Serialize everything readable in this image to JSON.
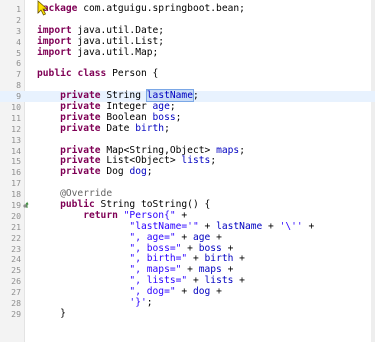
{
  "editor": {
    "lines": [
      {
        "num": "1",
        "text": "package com.atguigu.springboot.bean;"
      },
      {
        "num": "2",
        "text": ""
      },
      {
        "num": "3",
        "text": "import java.util.Date;"
      },
      {
        "num": "4",
        "text": "import java.util.List;"
      },
      {
        "num": "5",
        "text": "import java.util.Map;"
      },
      {
        "num": "6",
        "text": ""
      },
      {
        "num": "7",
        "text": "public class Person {"
      },
      {
        "num": "8",
        "text": ""
      },
      {
        "num": "9",
        "text": "    private String lastName;"
      },
      {
        "num": "10",
        "text": "    private Integer age;"
      },
      {
        "num": "11",
        "text": "    private Boolean boss;"
      },
      {
        "num": "12",
        "text": "    private Date birth;"
      },
      {
        "num": "13",
        "text": ""
      },
      {
        "num": "14",
        "text": "    private Map<String,Object> maps;"
      },
      {
        "num": "15",
        "text": "    private List<Object> lists;"
      },
      {
        "num": "16",
        "text": "    private Dog dog;"
      },
      {
        "num": "17",
        "text": ""
      },
      {
        "num": "18",
        "text": "    @Override"
      },
      {
        "num": "19",
        "text": "    public String toString() {"
      },
      {
        "num": "20",
        "text": "        return \"Person{\" +"
      },
      {
        "num": "21",
        "text": "                \"lastName='\" + lastName + '\\'' +"
      },
      {
        "num": "22",
        "text": "                \", age=\" + age +"
      },
      {
        "num": "23",
        "text": "                \", boss=\" + boss +"
      },
      {
        "num": "24",
        "text": "                \", birth=\" + birth +"
      },
      {
        "num": "25",
        "text": "                \", maps=\" + maps +"
      },
      {
        "num": "26",
        "text": "                \", lists=\" + lists +"
      },
      {
        "num": "27",
        "text": "                \", dog=\" + dog +"
      },
      {
        "num": "28",
        "text": "                '}';"
      },
      {
        "num": "29",
        "text": "    }"
      }
    ],
    "current_line": "9",
    "selected_word": "lastName",
    "colors": {
      "keyword": "#7f0055",
      "string": "#2a00ff",
      "field": "#0000c0",
      "annotation": "#646464",
      "line_number": "#8e8e8e",
      "current_line_bg": "#e8f2fe",
      "selection_bg": "#c9dcf7",
      "gutter_bg": "#f3f3f3"
    },
    "markers": {
      "override_line": "19",
      "override_icon": "override-up-arrow-icon",
      "cursor_icon": "yellow-arrow-cursor-icon"
    }
  }
}
